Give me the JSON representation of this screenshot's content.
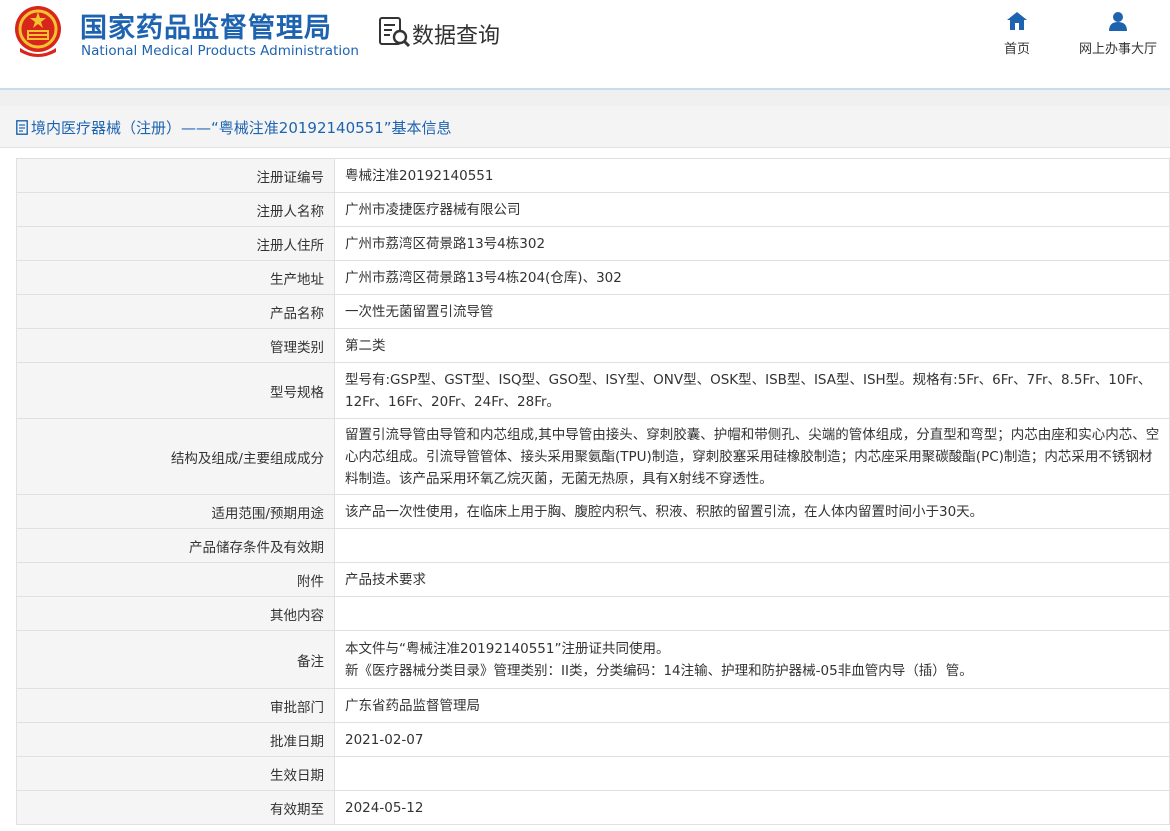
{
  "header": {
    "org_name_cn": "国家药品监督管理局",
    "org_name_en": "National Medical Products Administration",
    "emblem_icon": "national-emblem-icon",
    "query_icon": "document-search-icon",
    "query_title": "数据查询",
    "nav": {
      "home_label": "首页",
      "home_icon": "home-icon",
      "hall_label": "网上办事大厅",
      "hall_icon": "user-icon"
    },
    "accent_color": "#1e63b0"
  },
  "title_bar": {
    "icon": "document-icon",
    "text": "境内医疗器械（注册）——“粤械注准20192140551”基本信息"
  },
  "table": [
    {
      "label": "注册证编号",
      "value": [
        "粤械注准20192140551"
      ]
    },
    {
      "label": "注册人名称",
      "value": [
        "广州市凌捷医疗器械有限公司"
      ]
    },
    {
      "label": "注册人住所",
      "value": [
        "广州市荔湾区荷景路13号4栋302"
      ]
    },
    {
      "label": "生产地址",
      "value": [
        "广州市荔湾区荷景路13号4栋204(仓库)、302"
      ]
    },
    {
      "label": "产品名称",
      "value": [
        "一次性无菌留置引流导管"
      ]
    },
    {
      "label": "管理类别",
      "value": [
        "第二类"
      ]
    },
    {
      "label": "型号规格",
      "value": [
        "型号有:GSP型、GST型、ISQ型、GSO型、ISY型、ONV型、OSK型、ISB型、ISA型、ISH型。规格有:5Fr、6Fr、7Fr、8.5Fr、10Fr、12Fr、16Fr、20Fr、24Fr、28Fr。"
      ]
    },
    {
      "label": "结构及组成/主要组成成分",
      "value": [
        "留置引流导管由导管和内芯组成,其中导管由接头、穿刺胶囊、护帽和带侧孔、尖端的管体组成，分直型和弯型；内芯由座和实心内芯、空心内芯组成。引流导管管体、接头采用聚氨酯(TPU)制造，穿刺胶塞采用硅橡胶制造；内芯座采用聚碳酸酯(PC)制造；内芯采用不锈钢材料制造。该产品采用环氧乙烷灭菌，无菌无热原，具有X射线不穿透性。"
      ]
    },
    {
      "label": "适用范围/预期用途",
      "value": [
        "该产品一次性使用，在临床上用于胸、腹腔内积气、积液、积脓的留置引流，在人体内留置时间小于30天。"
      ]
    },
    {
      "label": "产品储存条件及有效期",
      "value": [
        ""
      ]
    },
    {
      "label": "附件",
      "value": [
        "产品技术要求"
      ]
    },
    {
      "label": "其他内容",
      "value": [
        ""
      ]
    },
    {
      "label": "备注",
      "value": [
        "本文件与“粤械注准20192140551”注册证共同使用。",
        "新《医疗器械分类目录》管理类别：II类，分类编码：14注输、护理和防护器械-05非血管内导（插）管。"
      ]
    },
    {
      "label": "审批部门",
      "value": [
        "广东省药品监督管理局"
      ]
    },
    {
      "label": "批准日期",
      "value": [
        "2021-02-07"
      ]
    },
    {
      "label": "生效日期",
      "value": [
        ""
      ]
    },
    {
      "label": "有效期至",
      "value": [
        "2024-05-12"
      ]
    }
  ]
}
